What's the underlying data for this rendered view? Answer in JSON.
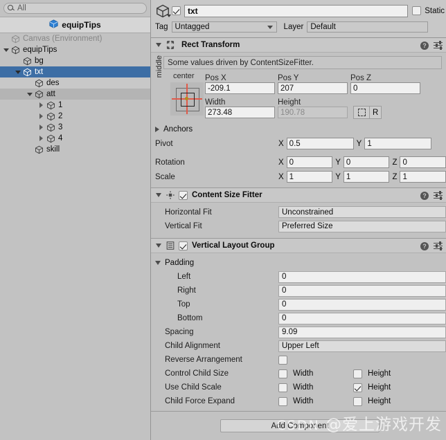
{
  "hierarchy": {
    "search": {
      "placeholder": "All",
      "value": "",
      "icon": "search-icon"
    },
    "header": {
      "title": "equipTips",
      "icon": "prefab-cube-icon"
    },
    "tree": [
      {
        "label": "Canvas (Environment)",
        "depth": 0,
        "twisty": "none",
        "state": "dim",
        "icon": "gameobject-cube-icon"
      },
      {
        "label": "equipTips",
        "depth": 0,
        "twisty": "open",
        "state": "normal",
        "icon": "gameobject-cube-icon"
      },
      {
        "label": "bg",
        "depth": 1,
        "twisty": "none",
        "state": "normal",
        "icon": "gameobject-cube-icon"
      },
      {
        "label": "txt",
        "depth": 1,
        "twisty": "open",
        "state": "selected",
        "icon": "gameobject-cube-icon"
      },
      {
        "label": "des",
        "depth": 2,
        "twisty": "none",
        "state": "alt",
        "icon": "gameobject-cube-icon"
      },
      {
        "label": "att",
        "depth": 2,
        "twisty": "open",
        "state": "hover",
        "icon": "gameobject-cube-icon"
      },
      {
        "label": "1",
        "depth": 3,
        "twisty": "closed",
        "state": "normal",
        "icon": "gameobject-cube-icon"
      },
      {
        "label": "2",
        "depth": 3,
        "twisty": "closed",
        "state": "normal",
        "icon": "gameobject-cube-icon"
      },
      {
        "label": "3",
        "depth": 3,
        "twisty": "closed",
        "state": "normal",
        "icon": "gameobject-cube-icon"
      },
      {
        "label": "4",
        "depth": 3,
        "twisty": "closed",
        "state": "normal",
        "icon": "gameobject-cube-icon"
      },
      {
        "label": "skill",
        "depth": 2,
        "twisty": "none",
        "state": "normal",
        "icon": "gameobject-cube-icon"
      }
    ]
  },
  "inspector": {
    "object": {
      "enabled_checkbox": true,
      "name": "txt",
      "static_label": "Static",
      "static_checked": false,
      "tag_label": "Tag",
      "tag_value": "Untagged",
      "layer_label": "Layer",
      "layer_value": "Default"
    },
    "rect_transform": {
      "title": "Rect Transform",
      "expanded": true,
      "notice": "Some values driven by ContentSizeFitter.",
      "anchor_preset": {
        "horizontal": "center",
        "vertical": "middle"
      },
      "pos_x_label": "Pos X",
      "pos_y_label": "Pos Y",
      "pos_z_label": "Pos Z",
      "pos_x": "-209.1",
      "pos_y": "207",
      "pos_z": "0",
      "width_label": "Width",
      "height_label": "Height",
      "width": "273.48",
      "height": "190.78",
      "height_disabled": true,
      "blueprint_icon": "blueprint-mode-icon",
      "raw_label": "R",
      "anchors_label": "Anchors",
      "anchors_expanded": false,
      "pivot_label": "Pivot",
      "pivot_x": "0.5",
      "pivot_y": "1",
      "rotation_label": "Rotation",
      "rotation_x": "0",
      "rotation_y": "0",
      "rotation_z": "0",
      "scale_label": "Scale",
      "scale_x": "1",
      "scale_y": "1",
      "scale_z": "1",
      "axis_x": "X",
      "axis_y": "Y",
      "axis_z": "Z"
    },
    "content_size_fitter": {
      "title": "Content Size Fitter",
      "enabled": true,
      "expanded": true,
      "horizontal_fit_label": "Horizontal Fit",
      "horizontal_fit_value": "Unconstrained",
      "vertical_fit_label": "Vertical Fit",
      "vertical_fit_value": "Preferred Size"
    },
    "vertical_layout_group": {
      "title": "Vertical Layout Group",
      "enabled": true,
      "expanded": true,
      "padding_label": "Padding",
      "padding_expanded": true,
      "left_label": "Left",
      "left": "0",
      "right_label": "Right",
      "right": "0",
      "top_label": "Top",
      "top": "0",
      "bottom_label": "Bottom",
      "bottom": "0",
      "spacing_label": "Spacing",
      "spacing": "9.09",
      "child_alignment_label": "Child Alignment",
      "child_alignment": "Upper Left",
      "reverse_arrangement_label": "Reverse Arrangement",
      "reverse_arrangement": false,
      "control_child_size_label": "Control Child Size",
      "control_child_size_width": false,
      "control_child_size_height": false,
      "use_child_scale_label": "Use Child Scale",
      "use_child_scale_width": false,
      "use_child_scale_height": true,
      "child_force_expand_label": "Child Force Expand",
      "child_force_expand_width": false,
      "child_force_expand_height": false,
      "width_label": "Width",
      "height_label": "Height"
    },
    "add_component_label": "Add Component",
    "help_icon": "help-icon",
    "preset_icon": "preset-settings-icon"
  },
  "watermark": {
    "text": "CSDN @爱上游戏开发",
    "prefix": "CSDN",
    "suffix": "@爱上游戏开发"
  },
  "colors": {
    "panel_bg": "#c2c2c2",
    "header_bg": "#c8c8c8",
    "selection_blue": "#3d6ea5",
    "field_bg": "#f0f0f0",
    "anchor_cross": "#e05a4a",
    "pivot_dot": "#b48a1a",
    "prefab_blue": "#2d7fd3"
  }
}
